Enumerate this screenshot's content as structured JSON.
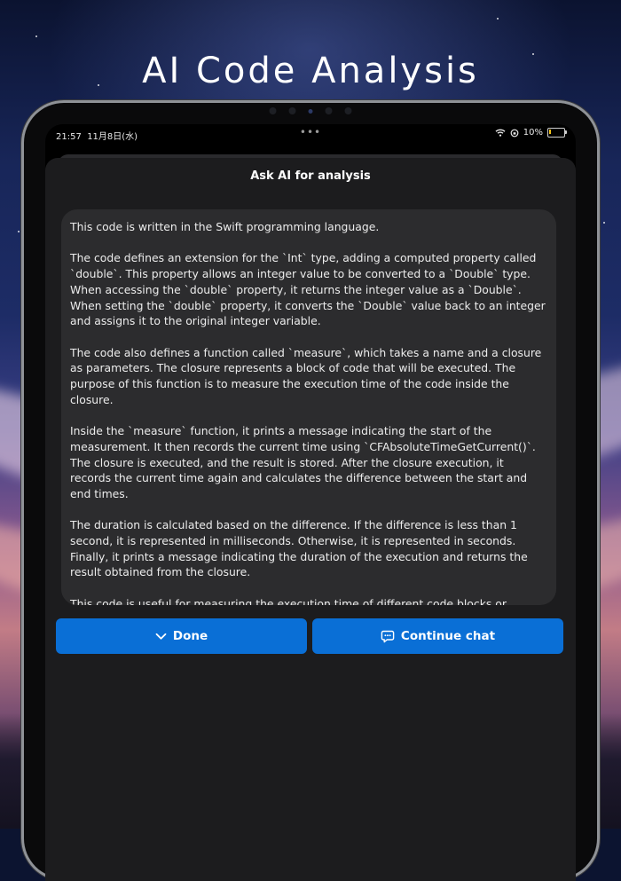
{
  "headline": "AI Code Analysis",
  "status": {
    "time": "21:57",
    "date": "11月8日(水)",
    "dots": "•••",
    "battery_percent": "10%",
    "battery_level": 0.1,
    "icons": [
      "wifi-icon",
      "orientation-lock-icon",
      "battery-charging-icon"
    ]
  },
  "sheet": {
    "title": "Ask AI for analysis",
    "paragraphs": [
      "This code is written in the Swift programming language.",
      "The code defines an extension for the `Int` type, adding a computed property called `double`. This property allows an integer value to be converted to a `Double` type. When accessing the `double` property, it returns the integer value as a `Double`. When setting the `double` property, it converts the `Double` value back to an integer and assigns it to the original integer variable.",
      "The code also defines a function called `measure`, which takes a name and a closure as parameters. The closure represents a block of code that will be executed. The purpose of this function is to measure the execution time of the code inside the closure.",
      "Inside the `measure` function, it prints a message indicating the start of the measurement. It then records the current time using `CFAbsoluteTimeGetCurrent()`. The closure is executed, and the result is stored. After the closure execution, it records the current time again and calculates the difference between the start and end times.",
      "The duration is calculated based on the difference. If the difference is less than 1 second, it is represented in milliseconds. Otherwise, it is represented in seconds. Finally, it prints a message indicating the duration of the execution and returns the result obtained from the closure.",
      "This code is useful for measuring the execution time of different code blocks or functions, which can be helpful for performance analysis and optimization."
    ]
  },
  "buttons": {
    "done_label": "Done",
    "done_icon": "chevron-down-icon",
    "continue_label": "Continue chat",
    "continue_icon": "chat-bubble-icon"
  },
  "colors": {
    "accent": "#0a6fd6",
    "sheet_bg": "#1c1c1e",
    "content_bg": "#2c2c2e",
    "text": "#ececec"
  }
}
